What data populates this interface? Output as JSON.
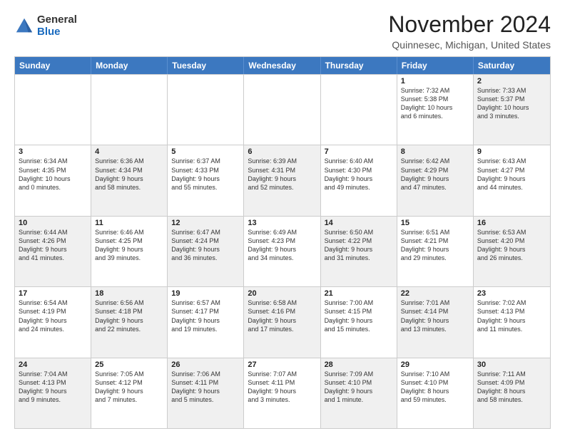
{
  "logo": {
    "general": "General",
    "blue": "Blue"
  },
  "title": "November 2024",
  "location": "Quinnesec, Michigan, United States",
  "days_of_week": [
    "Sunday",
    "Monday",
    "Tuesday",
    "Wednesday",
    "Thursday",
    "Friday",
    "Saturday"
  ],
  "weeks": [
    [
      {
        "day": "",
        "content": "",
        "shaded": false
      },
      {
        "day": "",
        "content": "",
        "shaded": false
      },
      {
        "day": "",
        "content": "",
        "shaded": false
      },
      {
        "day": "",
        "content": "",
        "shaded": false
      },
      {
        "day": "",
        "content": "",
        "shaded": false
      },
      {
        "day": "1",
        "content": "Sunrise: 7:32 AM\nSunset: 5:38 PM\nDaylight: 10 hours\nand 6 minutes.",
        "shaded": false
      },
      {
        "day": "2",
        "content": "Sunrise: 7:33 AM\nSunset: 5:37 PM\nDaylight: 10 hours\nand 3 minutes.",
        "shaded": true
      }
    ],
    [
      {
        "day": "3",
        "content": "Sunrise: 6:34 AM\nSunset: 4:35 PM\nDaylight: 10 hours\nand 0 minutes.",
        "shaded": false
      },
      {
        "day": "4",
        "content": "Sunrise: 6:36 AM\nSunset: 4:34 PM\nDaylight: 9 hours\nand 58 minutes.",
        "shaded": true
      },
      {
        "day": "5",
        "content": "Sunrise: 6:37 AM\nSunset: 4:33 PM\nDaylight: 9 hours\nand 55 minutes.",
        "shaded": false
      },
      {
        "day": "6",
        "content": "Sunrise: 6:39 AM\nSunset: 4:31 PM\nDaylight: 9 hours\nand 52 minutes.",
        "shaded": true
      },
      {
        "day": "7",
        "content": "Sunrise: 6:40 AM\nSunset: 4:30 PM\nDaylight: 9 hours\nand 49 minutes.",
        "shaded": false
      },
      {
        "day": "8",
        "content": "Sunrise: 6:42 AM\nSunset: 4:29 PM\nDaylight: 9 hours\nand 47 minutes.",
        "shaded": true
      },
      {
        "day": "9",
        "content": "Sunrise: 6:43 AM\nSunset: 4:27 PM\nDaylight: 9 hours\nand 44 minutes.",
        "shaded": false
      }
    ],
    [
      {
        "day": "10",
        "content": "Sunrise: 6:44 AM\nSunset: 4:26 PM\nDaylight: 9 hours\nand 41 minutes.",
        "shaded": true
      },
      {
        "day": "11",
        "content": "Sunrise: 6:46 AM\nSunset: 4:25 PM\nDaylight: 9 hours\nand 39 minutes.",
        "shaded": false
      },
      {
        "day": "12",
        "content": "Sunrise: 6:47 AM\nSunset: 4:24 PM\nDaylight: 9 hours\nand 36 minutes.",
        "shaded": true
      },
      {
        "day": "13",
        "content": "Sunrise: 6:49 AM\nSunset: 4:23 PM\nDaylight: 9 hours\nand 34 minutes.",
        "shaded": false
      },
      {
        "day": "14",
        "content": "Sunrise: 6:50 AM\nSunset: 4:22 PM\nDaylight: 9 hours\nand 31 minutes.",
        "shaded": true
      },
      {
        "day": "15",
        "content": "Sunrise: 6:51 AM\nSunset: 4:21 PM\nDaylight: 9 hours\nand 29 minutes.",
        "shaded": false
      },
      {
        "day": "16",
        "content": "Sunrise: 6:53 AM\nSunset: 4:20 PM\nDaylight: 9 hours\nand 26 minutes.",
        "shaded": true
      }
    ],
    [
      {
        "day": "17",
        "content": "Sunrise: 6:54 AM\nSunset: 4:19 PM\nDaylight: 9 hours\nand 24 minutes.",
        "shaded": false
      },
      {
        "day": "18",
        "content": "Sunrise: 6:56 AM\nSunset: 4:18 PM\nDaylight: 9 hours\nand 22 minutes.",
        "shaded": true
      },
      {
        "day": "19",
        "content": "Sunrise: 6:57 AM\nSunset: 4:17 PM\nDaylight: 9 hours\nand 19 minutes.",
        "shaded": false
      },
      {
        "day": "20",
        "content": "Sunrise: 6:58 AM\nSunset: 4:16 PM\nDaylight: 9 hours\nand 17 minutes.",
        "shaded": true
      },
      {
        "day": "21",
        "content": "Sunrise: 7:00 AM\nSunset: 4:15 PM\nDaylight: 9 hours\nand 15 minutes.",
        "shaded": false
      },
      {
        "day": "22",
        "content": "Sunrise: 7:01 AM\nSunset: 4:14 PM\nDaylight: 9 hours\nand 13 minutes.",
        "shaded": true
      },
      {
        "day": "23",
        "content": "Sunrise: 7:02 AM\nSunset: 4:13 PM\nDaylight: 9 hours\nand 11 minutes.",
        "shaded": false
      }
    ],
    [
      {
        "day": "24",
        "content": "Sunrise: 7:04 AM\nSunset: 4:13 PM\nDaylight: 9 hours\nand 9 minutes.",
        "shaded": true
      },
      {
        "day": "25",
        "content": "Sunrise: 7:05 AM\nSunset: 4:12 PM\nDaylight: 9 hours\nand 7 minutes.",
        "shaded": false
      },
      {
        "day": "26",
        "content": "Sunrise: 7:06 AM\nSunset: 4:11 PM\nDaylight: 9 hours\nand 5 minutes.",
        "shaded": true
      },
      {
        "day": "27",
        "content": "Sunrise: 7:07 AM\nSunset: 4:11 PM\nDaylight: 9 hours\nand 3 minutes.",
        "shaded": false
      },
      {
        "day": "28",
        "content": "Sunrise: 7:09 AM\nSunset: 4:10 PM\nDaylight: 9 hours\nand 1 minute.",
        "shaded": true
      },
      {
        "day": "29",
        "content": "Sunrise: 7:10 AM\nSunset: 4:10 PM\nDaylight: 8 hours\nand 59 minutes.",
        "shaded": false
      },
      {
        "day": "30",
        "content": "Sunrise: 7:11 AM\nSunset: 4:09 PM\nDaylight: 8 hours\nand 58 minutes.",
        "shaded": true
      }
    ]
  ]
}
